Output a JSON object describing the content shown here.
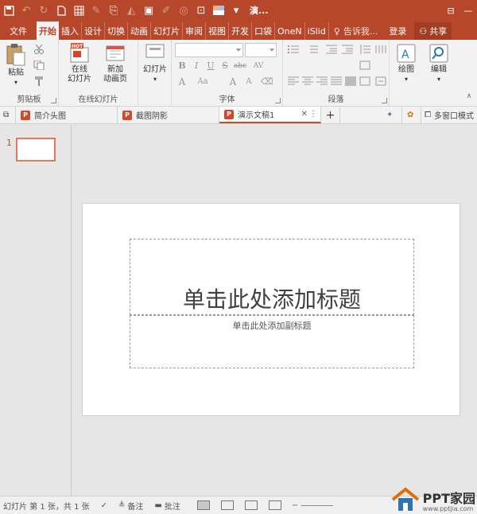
{
  "titlebar": {
    "doc_title": "演...",
    "bg": "#b7472a",
    "quick_access": [
      "save-icon",
      "undo-icon",
      "redo-icon",
      "new-doc-icon",
      "table-icon",
      "eyedropper-icon",
      "format-icon",
      "fill-icon",
      "clipboard-icon",
      "brush-icon",
      "shape-icon",
      "screenshot-icon",
      "theme-icon"
    ]
  },
  "tabs": {
    "file": "文件",
    "items": [
      "开始",
      "插入",
      "设计",
      "切换",
      "动画",
      "幻灯片",
      "审阅",
      "视图",
      "开发",
      "口袋",
      "OneN",
      "iSlid"
    ],
    "active": "开始",
    "tellme": "告诉我...",
    "login": "登录",
    "share": "共享"
  },
  "ribbon": {
    "clipboard": {
      "paste": "粘贴",
      "label": "剪贴板"
    },
    "online_slides": {
      "online": "在线\n幻灯片",
      "new_anim": "新加\n动画页",
      "label": "在线幻灯片",
      "hot": "HOT"
    },
    "slides": {
      "slide": "幻灯片"
    },
    "font": {
      "label": "字体",
      "bold": "B",
      "italic": "I",
      "underline": "U",
      "strike": "S",
      "abc": "abc",
      "av": "AV",
      "aa": "Aa"
    },
    "paragraph": {
      "label": "段落"
    },
    "drawing": {
      "label": "绘图"
    },
    "editing": {
      "label": "编辑"
    }
  },
  "doctabs": {
    "items": [
      {
        "name": "简介头图",
        "active": false
      },
      {
        "name": "截图阴影",
        "active": false
      },
      {
        "name": "演示文稿1",
        "active": true
      }
    ],
    "close": "✕",
    "add": "+",
    "multiwindow": "多窗口模式"
  },
  "thumbnail": {
    "number": "1"
  },
  "slide": {
    "title_placeholder": "单击此处添加标题",
    "subtitle_placeholder": "单击此处添加副标题"
  },
  "statusbar": {
    "slide_info": "幻灯片 第 1 张，共 1 张",
    "notes": "备注",
    "comments": "批注"
  },
  "watermark": {
    "brand": "PPT家园",
    "url": "www.pptjia.com"
  }
}
